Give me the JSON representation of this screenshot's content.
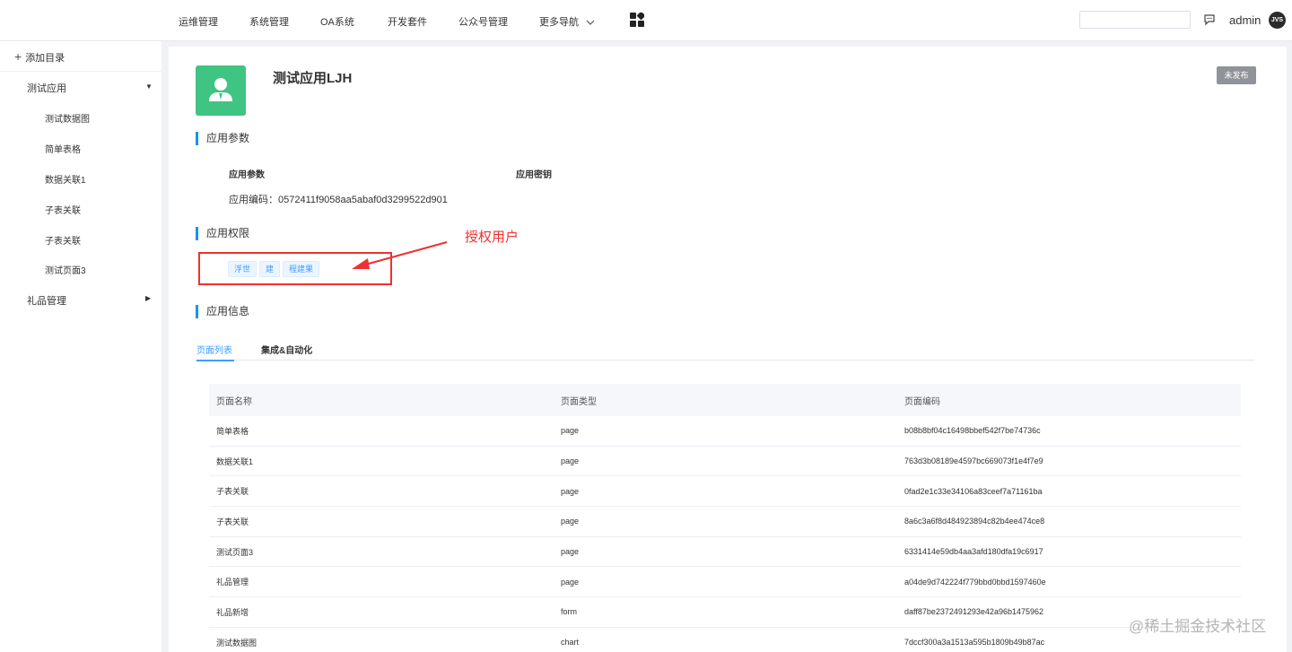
{
  "topnav": {
    "items": [
      "运维管理",
      "系统管理",
      "OA系统",
      "开发套件",
      "公众号管理",
      "更多导航"
    ],
    "username": "admin",
    "avatar_text": "JVS",
    "search_placeholder": ""
  },
  "sidebar": {
    "add_label": "添加目录",
    "groups": [
      {
        "label": "测试应用",
        "expanded": true
      },
      {
        "label": "礼品管理",
        "expanded": false
      }
    ],
    "items": [
      "测试数据图",
      "简单表格",
      "数据关联1",
      "子表关联",
      "子表关联",
      "测试页面3"
    ]
  },
  "app": {
    "title": "测试应用LJH",
    "status": "未发布"
  },
  "sections": {
    "params": "应用参数",
    "permissions": "应用权限",
    "info": "应用信息"
  },
  "params": {
    "col1_label": "应用参数",
    "col2_label": "应用密钥",
    "code_line": "应用编码：0572411f9058aa5abaf0d3299522d901"
  },
  "permissions": {
    "tags": [
      "浮世",
      "建",
      "程建果"
    ],
    "annotation": "授权用户"
  },
  "tabs": [
    "页面列表",
    "集成&自动化"
  ],
  "table": {
    "headers": [
      "页面名称",
      "页面类型",
      "页面编码"
    ],
    "rows": [
      [
        "简单表格",
        "page",
        "b08b8bf04c16498bbef542f7be74736c"
      ],
      [
        "数据关联1",
        "page",
        "763d3b08189e4597bc669073f1e4f7e9"
      ],
      [
        "子表关联",
        "page",
        "0fad2e1c33e34106a83ceef7a71161ba"
      ],
      [
        "子表关联",
        "page",
        "8a6c3a6f8d484923894c82b4ee474ce8"
      ],
      [
        "测试页面3",
        "page",
        "6331414e59db4aa3afd180dfa19c6917"
      ],
      [
        "礼品管理",
        "page",
        "a04de9d742224f779bbd0bbd1597460e"
      ],
      [
        "礼品新增",
        "form",
        "daff87be2372491293e42a96b1475962"
      ],
      [
        "测试数据图",
        "chart",
        "7dccf300a3a1513a595b1809b49b87ac"
      ]
    ]
  },
  "watermark": "@稀土掘金技术社区",
  "colors": {
    "accent": "#409eff",
    "app_icon_bg": "#3fc581",
    "annotation_red": "#f0302f",
    "status_gray": "#909399"
  }
}
